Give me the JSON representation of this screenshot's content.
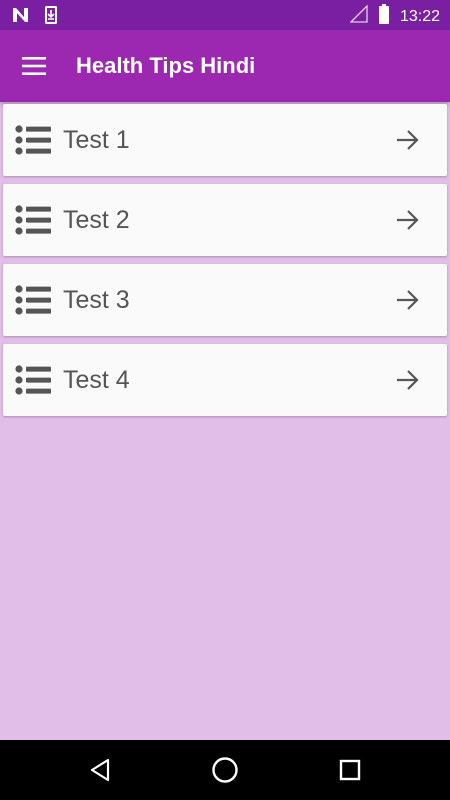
{
  "status_bar": {
    "time": "13:22",
    "icons": [
      "n-notification-icon",
      "download-icon",
      "signal-icon",
      "battery-icon"
    ]
  },
  "app_bar": {
    "title": "Health Tips Hindi",
    "menu_icon": "menu-icon"
  },
  "items": [
    {
      "label": "Test 1",
      "icon": "list-icon",
      "action_icon": "arrow-right-icon"
    },
    {
      "label": "Test 2",
      "icon": "list-icon",
      "action_icon": "arrow-right-icon"
    },
    {
      "label": "Test 3",
      "icon": "list-icon",
      "action_icon": "arrow-right-icon"
    },
    {
      "label": "Test 4",
      "icon": "list-icon",
      "action_icon": "arrow-right-icon"
    }
  ],
  "nav_bar": {
    "buttons": [
      "back-icon",
      "home-icon",
      "recents-icon"
    ]
  },
  "colors": {
    "status_bar": "#7b1fa2",
    "app_bar": "#9c27b0",
    "background": "#e1bee7",
    "card": "#fafafa",
    "text": "#555555"
  }
}
